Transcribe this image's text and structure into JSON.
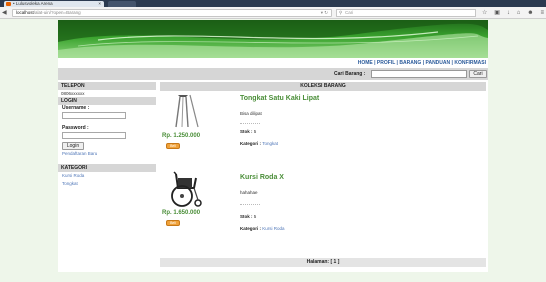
{
  "browser": {
    "tab_title": "• Lulusvoleka Arena",
    "url_host": "localhost",
    "url_path": "/alat-uin/?open=Barang",
    "search_placeholder": "Cari"
  },
  "menu": {
    "home": "HOME",
    "profil": "PROFIL",
    "barang": "BARANG",
    "panduan": "PANDUAN",
    "konfirmasi": "KONFIRMASI",
    "sep": " | "
  },
  "search": {
    "label": "Cari Barang :",
    "button": "Cari"
  },
  "sidebar": {
    "telepon_head": "TELEPON",
    "telepon_value": "0806xxxxxx",
    "login_head": "LOGIN",
    "username_label": "Username :",
    "password_label": "Password :",
    "login_button": "Login",
    "register_link": "Pendaftaran Baru",
    "kategori_head": "KATEGORI",
    "kategori": [
      "Kursi Roda",
      "Tongkat"
    ]
  },
  "main": {
    "title": "KOLEKSI BARANG",
    "products": [
      {
        "name": "Tongkat Satu Kaki Lipat",
        "description": "Bisa dilipat",
        "stok_label": "Stok :",
        "stok": "5",
        "kategori_label": "Kategori :",
        "kategori": "Tongkat",
        "price": "Rp. 1.250.000",
        "buy": "Beli",
        "image_icon": "cane-image"
      },
      {
        "name": "Kursi Roda X",
        "description": "hahahae",
        "stok_label": "Stok :",
        "stok": "5",
        "kategori_label": "Kategori :",
        "kategori": "Kursi Roda",
        "price": "Rp. 1.650.000",
        "buy": "Beli",
        "image_icon": "wheelchair-image"
      }
    ],
    "pager": "Halaman: [ 1 ]"
  },
  "colors": {
    "accent_green": "#4a8e38",
    "link_blue": "#5077b8",
    "menu_blue": "#2a5a9a",
    "header_gray": "#d6d6d6",
    "buy_orange": "#f0a23a"
  }
}
